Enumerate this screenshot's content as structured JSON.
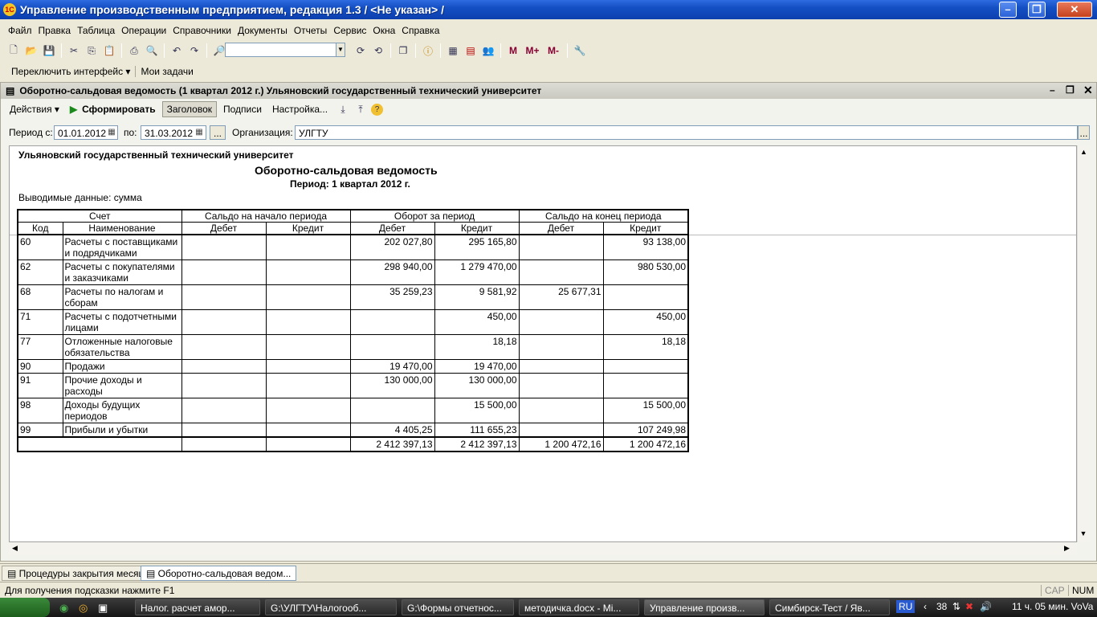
{
  "window": {
    "title": "Управление производственным предприятием, редакция 1.3 / <Не указан> /",
    "logo": "1С"
  },
  "menu": [
    "Файл",
    "Правка",
    "Таблица",
    "Операции",
    "Справочники",
    "Документы",
    "Отчеты",
    "Сервис",
    "Окна",
    "Справка"
  ],
  "toolbar": {
    "m": "M",
    "mplus": "M+",
    "mminus": "M-"
  },
  "iface": {
    "switch": "Переключить интерфейс ▾",
    "tasks": "Мои задачи"
  },
  "doc": {
    "title": "Оборотно-сальдовая ведомость (1 квартал 2012 г.) Ульяновский государственный технический университет",
    "actions": {
      "actions": "Действия ▾",
      "run": "Сформировать",
      "header": "Заголовок",
      "signs": "Подписи",
      "settings": "Настройка..."
    },
    "params": {
      "from_label": "Период с:",
      "from": "01.01.2012",
      "to_label": "по:",
      "to": "31.03.2012",
      "dots": "...",
      "org_label": "Организация:",
      "org": "УЛГТУ"
    }
  },
  "report": {
    "org": "Ульяновский государственный технический университет",
    "title": "Оборотно-сальдовая ведомость",
    "period": "Период: 1 квартал 2012 г.",
    "data_shown": "Выводимые данные: сумма",
    "head1": {
      "account": "Счет",
      "start": "Сальдо на начало периода",
      "turn": "Оборот за период",
      "end": "Сальдо на конец периода"
    },
    "head2": {
      "code": "Код",
      "name": "Наименование",
      "debit": "Дебет",
      "credit": "Кредит"
    },
    "rows": [
      {
        "code": "60",
        "name": "Расчеты с поставщиками и подрядчиками",
        "sd": "",
        "sc": "",
        "td": "202 027,80",
        "tc": "295 165,80",
        "ed": "",
        "ec": "93 138,00"
      },
      {
        "code": "62",
        "name": "Расчеты с покупателями и заказчиками",
        "sd": "",
        "sc": "",
        "td": "298 940,00",
        "tc": "1 279 470,00",
        "ed": "",
        "ec": "980 530,00"
      },
      {
        "code": "68",
        "name": "Расчеты по налогам и сборам",
        "sd": "",
        "sc": "",
        "td": "35 259,23",
        "tc": "9 581,92",
        "ed": "25 677,31",
        "ec": ""
      },
      {
        "code": "71",
        "name": "Расчеты с подотчетными лицами",
        "sd": "",
        "sc": "",
        "td": "",
        "tc": "450,00",
        "ed": "",
        "ec": "450,00"
      },
      {
        "code": "77",
        "name": "Отложенные налоговые обязательства",
        "sd": "",
        "sc": "",
        "td": "",
        "tc": "18,18",
        "ed": "",
        "ec": "18,18"
      },
      {
        "code": "90",
        "name": "Продажи",
        "sd": "",
        "sc": "",
        "td": "19 470,00",
        "tc": "19 470,00",
        "ed": "",
        "ec": ""
      },
      {
        "code": "91",
        "name": "Прочие доходы и расходы",
        "sd": "",
        "sc": "",
        "td": "130 000,00",
        "tc": "130 000,00",
        "ed": "",
        "ec": ""
      },
      {
        "code": "98",
        "name": "Доходы будущих периодов",
        "sd": "",
        "sc": "",
        "td": "",
        "tc": "15 500,00",
        "ed": "",
        "ec": "15 500,00"
      },
      {
        "code": "99",
        "name": "Прибыли и убытки",
        "sd": "",
        "sc": "",
        "td": "4 405,25",
        "tc": "111 655,23",
        "ed": "",
        "ec": "107 249,98"
      }
    ],
    "total": {
      "td": "2 412 397,13",
      "tc": "2 412 397,13",
      "ed": "1 200 472,16",
      "ec": "1 200 472,16"
    }
  },
  "tabs": [
    "Процедуры закрытия месяца",
    "Оборотно-сальдовая ведом..."
  ],
  "status": {
    "hint": "Для получения подсказки нажмите F1",
    "cap": "CAP",
    "num": "NUM"
  },
  "taskbar": {
    "items": [
      "Налог. расчет амор...",
      "G:\\УЛГТУ\\Налогооб...",
      "G:\\Формы отчетнос...",
      "методичка.docx - Mi...",
      "Управление произв...",
      "Симбирск-Тест / Яв..."
    ],
    "lang": "RU",
    "tray_num": "38",
    "clock": "11 ч. 05 мин. VoVa"
  }
}
